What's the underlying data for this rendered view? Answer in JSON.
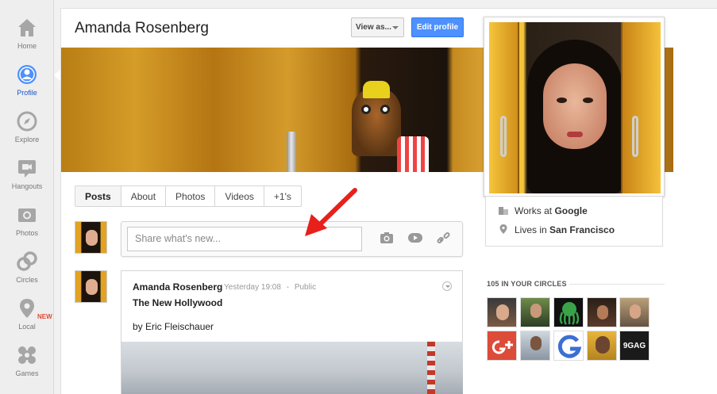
{
  "nav": {
    "items": [
      {
        "label": "Home",
        "icon": "home-icon",
        "active": false
      },
      {
        "label": "Profile",
        "icon": "profile-icon",
        "active": true
      },
      {
        "label": "Explore",
        "icon": "compass-icon",
        "active": false
      },
      {
        "label": "Hangouts",
        "icon": "video-camera-icon",
        "active": false
      },
      {
        "label": "Photos",
        "icon": "camera-icon",
        "active": false
      },
      {
        "label": "Circles",
        "icon": "circles-icon",
        "active": false
      },
      {
        "label": "Local",
        "icon": "location-pin-icon",
        "active": false,
        "badge": "NEW"
      },
      {
        "label": "Games",
        "icon": "puzzle-icon",
        "active": false
      }
    ]
  },
  "profile": {
    "name": "Amanda Rosenberg",
    "view_as": "View as...",
    "edit": "Edit profile",
    "work_prefix": "Works at",
    "work_place": "Google",
    "lives_prefix": "Lives in",
    "lives_place": "San Francisco"
  },
  "tabs": [
    "Posts",
    "About",
    "Photos",
    "Videos",
    "+1's"
  ],
  "share": {
    "placeholder": "Share what's new..."
  },
  "post": {
    "author": "Amanda Rosenberg",
    "time": "Yesterday 19:08",
    "sep": "-",
    "visibility": "Public",
    "title": "The New Hollywood",
    "byline": "by Eric Fleischauer"
  },
  "circles": {
    "title": "105 IN YOUR CIRCLES",
    "last_label": "9GAG"
  },
  "colors": {
    "accent_blue": "#4d90fe",
    "active_nav": "#1a56c6",
    "badge_red": "#dd4b39",
    "annotation_arrow": "#e8201b"
  }
}
